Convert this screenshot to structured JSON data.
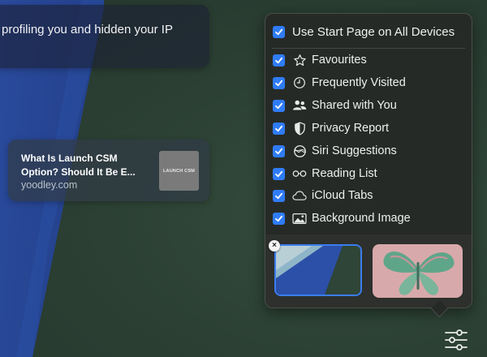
{
  "privacy_card": {
    "text": "profiling you and hidden your IP"
  },
  "reading_list_card": {
    "title": "What Is Launch CSM Option? Should It Be E...",
    "domain": "yoodley.com",
    "thumbnail_text": "LAUNCH CSM"
  },
  "customize_popover": {
    "use_start_page": {
      "label": "Use Start Page on All Devices",
      "checked": true
    },
    "sections": [
      {
        "label": "Favourites",
        "icon": "star-icon",
        "checked": true
      },
      {
        "label": "Frequently Visited",
        "icon": "clock-icon",
        "checked": true
      },
      {
        "label": "Shared with You",
        "icon": "people-icon",
        "checked": true
      },
      {
        "label": "Privacy Report",
        "icon": "shield-icon",
        "checked": true
      },
      {
        "label": "Siri Suggestions",
        "icon": "siri-icon",
        "checked": true
      },
      {
        "label": "Reading List",
        "icon": "glasses-icon",
        "checked": true
      },
      {
        "label": "iCloud Tabs",
        "icon": "cloud-icon",
        "checked": true
      },
      {
        "label": "Background Image",
        "icon": "photo-icon",
        "checked": true
      }
    ],
    "background_images": [
      {
        "name": "current-background",
        "selected": true
      },
      {
        "name": "butterfly-background",
        "selected": false
      }
    ]
  },
  "colors": {
    "accent": "#2f7cf6",
    "popover_bg": "#262a27",
    "page_bg": "#2b3f33"
  }
}
